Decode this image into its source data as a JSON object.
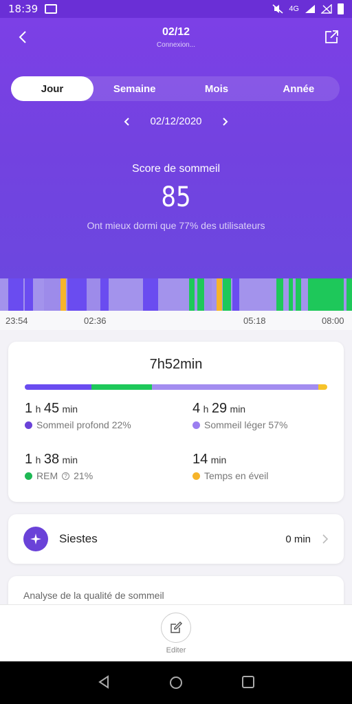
{
  "status_bar": {
    "time": "18:39",
    "network": "4G"
  },
  "header": {
    "title": "02/12",
    "subtitle": "Connexion..."
  },
  "tabs": [
    {
      "label": "Jour",
      "active": true
    },
    {
      "label": "Semaine",
      "active": false
    },
    {
      "label": "Mois",
      "active": false
    },
    {
      "label": "Année",
      "active": false
    }
  ],
  "date": "02/12/2020",
  "score": {
    "title": "Score de sommeil",
    "value": "85",
    "comparison": "Ont mieux dormi que 77% des utilisateurs"
  },
  "timeline": {
    "axis_labels": [
      "23:54",
      "02:36",
      "05:18",
      "08:00"
    ],
    "colors": {
      "deep": "#6a4cf0",
      "light": "#9d8bea",
      "rem": "#1ec85a",
      "awake": "#f6b42a"
    }
  },
  "summary": {
    "total": "7h52min",
    "bar_fractions": {
      "deep": 0.22,
      "rem": 0.2,
      "light": 0.55,
      "awake": 0.03
    },
    "deep": {
      "h": "1",
      "h_unit": "h",
      "m": "45",
      "m_unit": "min",
      "label": "Sommeil profond 22%"
    },
    "light": {
      "h": "4",
      "h_unit": "h",
      "m": "29",
      "m_unit": "min",
      "label": "Sommeil léger 57%"
    },
    "rem": {
      "h": "1",
      "h_unit": "h",
      "m": "38",
      "m_unit": "min",
      "label": "REM",
      "percent": "21%"
    },
    "awake": {
      "m": "14",
      "m_unit": "min",
      "label": "Temps en éveil"
    }
  },
  "naps": {
    "label": "Siestes",
    "value": "0 min"
  },
  "analysis": {
    "title": "Analyse de la qualité de sommeil"
  },
  "bottom": {
    "edit_label": "Editer"
  }
}
